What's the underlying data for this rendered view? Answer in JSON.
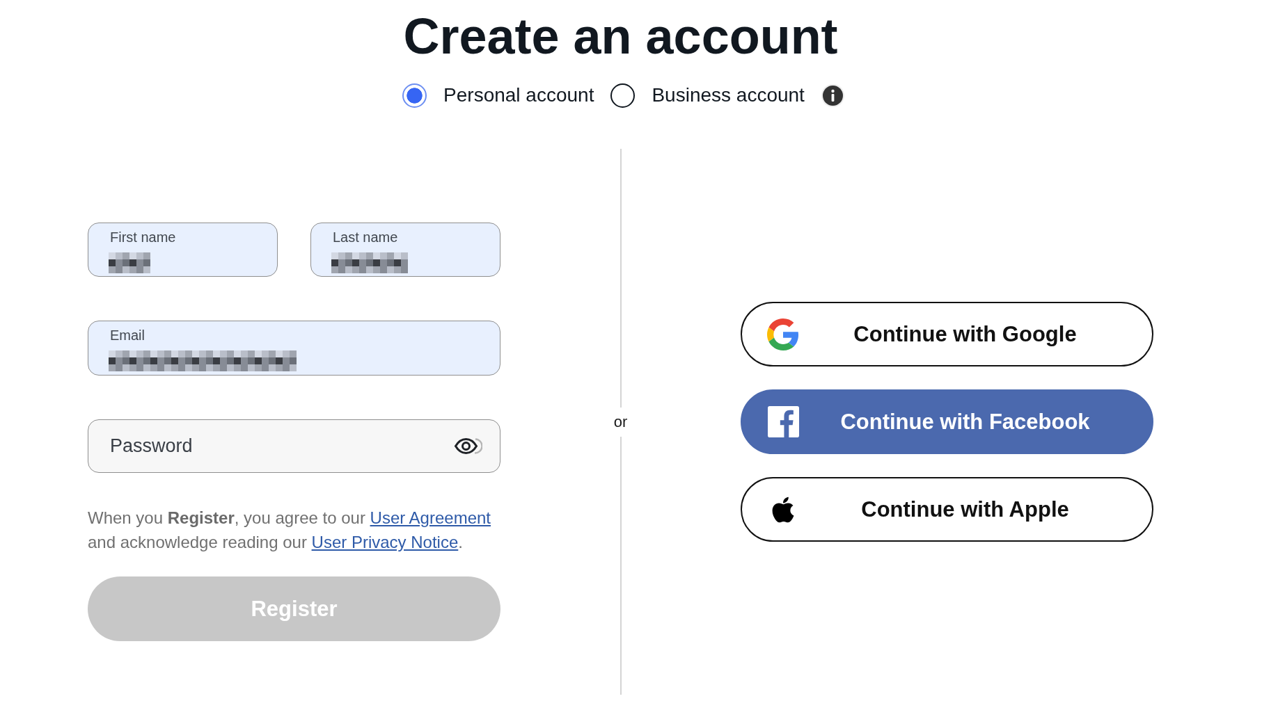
{
  "title": "Create an account",
  "account_types": [
    {
      "label": "Personal account",
      "selected": true
    },
    {
      "label": "Business account",
      "selected": false
    }
  ],
  "form": {
    "name_fields": [
      {
        "label": "First name",
        "autofilled": true,
        "redacted": true
      },
      {
        "label": "Last name",
        "autofilled": true,
        "redacted": true
      }
    ],
    "email_field": {
      "label": "Email",
      "autofilled": true,
      "redacted": true
    },
    "password_field": {
      "placeholder": "Password",
      "autofilled": false
    },
    "legal_text": [
      {
        "kind": "text",
        "text": "When you **Register**, you agree to our "
      },
      {
        "kind": "link",
        "text": "User Agreement"
      },
      {
        "kind": "text",
        "text": " and acknowledge reading our "
      },
      {
        "kind": "link",
        "text": "User Privacy Notice"
      },
      {
        "kind": "text",
        "text": "."
      }
    ],
    "register_button": {
      "label": "Register",
      "disabled": true
    }
  },
  "divider_label": "or",
  "social_buttons": [
    {
      "kind": "google",
      "label": "Continue with Google"
    },
    {
      "kind": "facebook",
      "label": "Continue with Facebook"
    },
    {
      "kind": "apple",
      "label": "Continue with Apple"
    }
  ]
}
